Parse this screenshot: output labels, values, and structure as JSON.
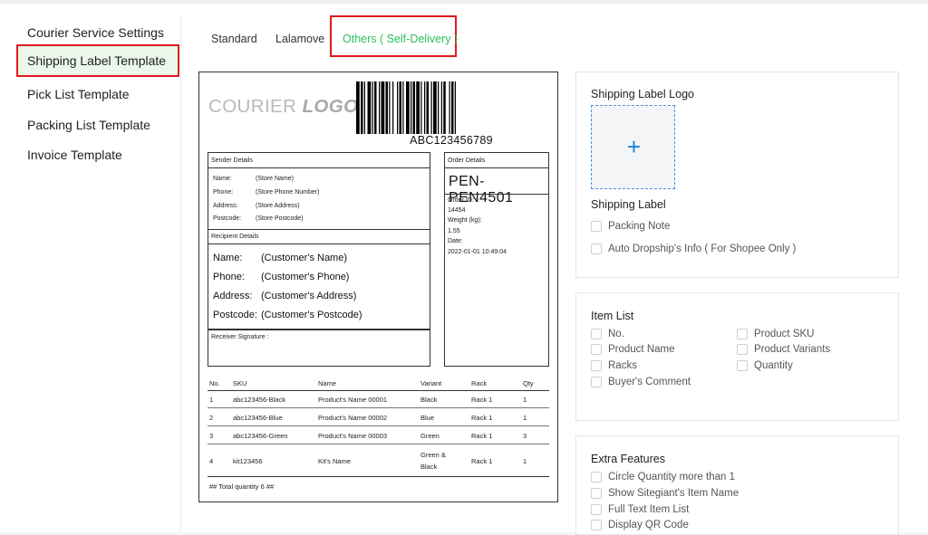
{
  "sidebar": {
    "items": [
      {
        "label": "Courier Service Settings"
      },
      {
        "label": "Shipping Label Template"
      },
      {
        "label": "Pick List Template"
      },
      {
        "label": "Packing List Template"
      },
      {
        "label": "Invoice Template"
      }
    ]
  },
  "tabs": [
    {
      "label": "Standard"
    },
    {
      "label": "Lalamove"
    },
    {
      "label": "Others ( Self-Delivery )"
    }
  ],
  "preview": {
    "logo_text": "COURIER",
    "logo_bold": "LOGO",
    "barcode_text": "ABC123456789",
    "sender": {
      "title": "Sender Details",
      "rows": [
        {
          "k": "Name:",
          "v": "(Store Name)"
        },
        {
          "k": "Phone:",
          "v": "(Store Phone Number)"
        },
        {
          "k": "Address:",
          "v": "(Store Address)"
        },
        {
          "k": "Postcode:",
          "v": "(Store Postcode)"
        }
      ]
    },
    "recipient": {
      "title": "Recipient Details",
      "rows": [
        {
          "k": "Name:",
          "v": "(Customer's Name)"
        },
        {
          "k": "Phone:",
          "v": "(Customer's Phone)"
        },
        {
          "k": "Address:",
          "v": "(Customer's Address)"
        },
        {
          "k": "Postcode:",
          "v": "(Customer's Postcode)"
        }
      ]
    },
    "signature": "Receiver Signature :",
    "order": {
      "title": "Order Details",
      "code": "PEN-PEN4501",
      "lines": [
        "Order ID:",
        "14454",
        "Weight (kg):",
        "1.55",
        "Date:",
        "2022-01-01 10:49:04"
      ]
    },
    "table": {
      "headers": [
        "No.",
        "SKU",
        "Name",
        "Variant",
        "Rack",
        "Qty"
      ],
      "rows": [
        [
          "1",
          "abc123456-Black",
          "Product's Name 00001",
          "Black",
          "Rack 1",
          "1"
        ],
        [
          "2",
          "abc123456-Blue",
          "Product's Name 00002",
          "Blue",
          "Rack 1",
          "1"
        ],
        [
          "3",
          "abc123456-Green",
          "Product's Name 00003",
          "Green",
          "Rack 1",
          "3"
        ],
        [
          "4",
          "kit123456",
          "Kit's Name",
          "Green &",
          "Rack 1",
          "1"
        ]
      ],
      "row4_variant_line2": "Black",
      "total": "## Total quantity 6 ##"
    }
  },
  "logo_panel": {
    "title": "Shipping Label Logo",
    "upload_icon": "plus-icon",
    "section_title": "Shipping Label",
    "options": [
      {
        "label": "Packing Note"
      },
      {
        "label": "Auto Dropship's Info ( For Shopee Only )"
      }
    ]
  },
  "item_list_panel": {
    "title": "Item List",
    "left_options": [
      {
        "label": "No."
      },
      {
        "label": "Product Name"
      },
      {
        "label": "Racks"
      },
      {
        "label": "Buyer's Comment"
      }
    ],
    "right_options": [
      {
        "label": "Product SKU"
      },
      {
        "label": "Product Variants"
      },
      {
        "label": "Quantity"
      }
    ]
  },
  "extra_panel": {
    "title": "Extra Features",
    "options": [
      {
        "label": "Circle Quantity more than 1"
      },
      {
        "label": "Show Sitegiant's Item Name"
      },
      {
        "label": "Full Text Item List"
      },
      {
        "label": "Display QR Code"
      }
    ]
  },
  "colors": {
    "active_tab": "#2fbf5a",
    "highlight_border": "#e0191f",
    "active_sidebar_bg": "#eaf7ea",
    "upload_accent": "#1a82d9"
  }
}
